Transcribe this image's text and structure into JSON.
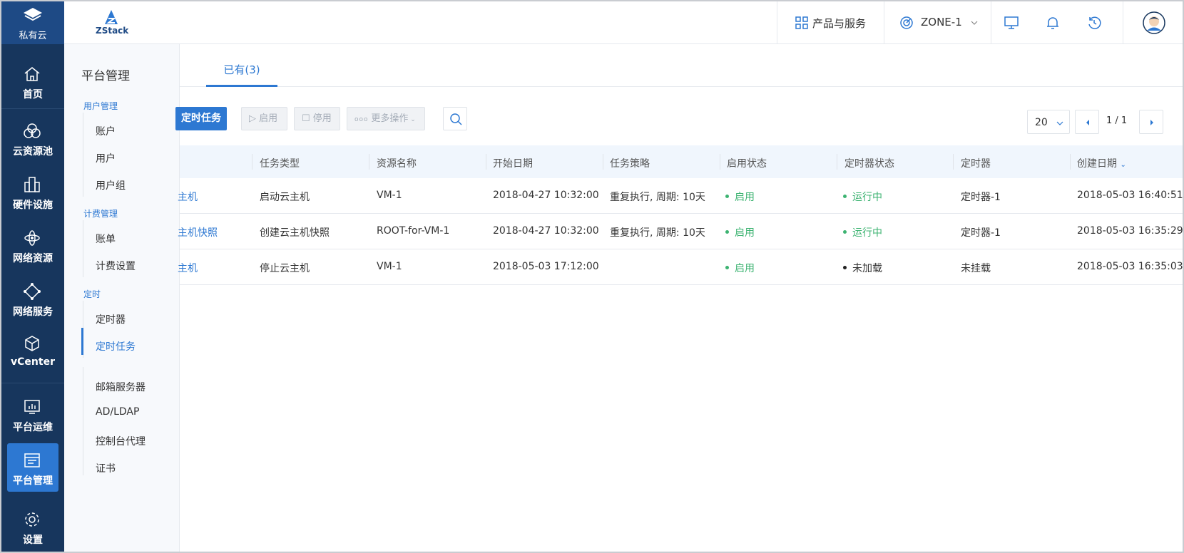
{
  "brand": {
    "product_label": "私有云",
    "logo_text": "ZStack"
  },
  "nav": {
    "items": [
      {
        "label": "首页",
        "icon": "home-icon"
      },
      {
        "label": "云资源池",
        "icon": "cloud-pool-icon"
      },
      {
        "label": "硬件设施",
        "icon": "hardware-icon"
      },
      {
        "label": "网络资源",
        "icon": "network-resource-icon"
      },
      {
        "label": "网络服务",
        "icon": "network-service-icon"
      },
      {
        "label": "vCenter",
        "icon": "vcenter-icon"
      },
      {
        "label": "平台运维",
        "icon": "ops-icon"
      },
      {
        "label": "平台管理",
        "icon": "platform-mgmt-icon"
      },
      {
        "label": "设置",
        "icon": "gear-icon"
      }
    ],
    "active_index": 7
  },
  "topbar": {
    "products_label": "产品与服务",
    "zone_label": "ZONE-1"
  },
  "submenu": {
    "title": "平台管理",
    "groups": [
      {
        "label": "用户管理",
        "items": [
          "账户",
          "用户",
          "用户组"
        ]
      },
      {
        "label": "计费管理",
        "items": [
          "账单",
          "计费设置"
        ]
      },
      {
        "label": "定时",
        "items": [
          "定时器",
          "定时任务"
        ]
      }
    ],
    "extra_items": [
      "邮箱服务器",
      "AD/LDAP",
      "控制台代理",
      "证书"
    ],
    "active_item": "定时任务"
  },
  "tabs": [
    {
      "label": "已有(3)"
    }
  ],
  "toolbar": {
    "create_label": "定时任务",
    "enable_label": "启用",
    "disable_label": "停用",
    "more_label": "更多操作"
  },
  "pager": {
    "page_size": "20",
    "page_text": "1 / 1"
  },
  "table": {
    "columns": [
      "任务类型",
      "资源名称",
      "开始日期",
      "任务策略",
      "启用状态",
      "定时器状态",
      "定时器",
      "创建日期"
    ],
    "rows": [
      {
        "name": "主机",
        "task_type": "启动云主机",
        "resource": "VM-1",
        "start_date": "2018-04-27 10:32:00",
        "policy": "重复执行, 周期: 10天",
        "enable_state": "启用",
        "timer_state": "运行中",
        "timer": "定时器-1",
        "created": "2018-05-03 16:40:51"
      },
      {
        "name": "主机快照",
        "task_type": "创建云主机快照",
        "resource": "ROOT-for-VM-1",
        "start_date": "2018-04-27 10:32:00",
        "policy": "重复执行, 周期: 10天",
        "enable_state": "启用",
        "timer_state": "运行中",
        "timer": "定时器-1",
        "created": "2018-05-03 16:35:29"
      },
      {
        "name": "主机",
        "task_type": "停止云主机",
        "resource": "VM-1",
        "start_date": "2018-05-03 17:12:00",
        "policy": "",
        "enable_state": "启用",
        "timer_state": "未加载",
        "timer": "未挂载",
        "created": "2018-05-03 16:35:03"
      }
    ]
  },
  "colors": {
    "accent": "#2d78d2",
    "nav_bg": "#17365d",
    "ok": "#3cb371"
  }
}
